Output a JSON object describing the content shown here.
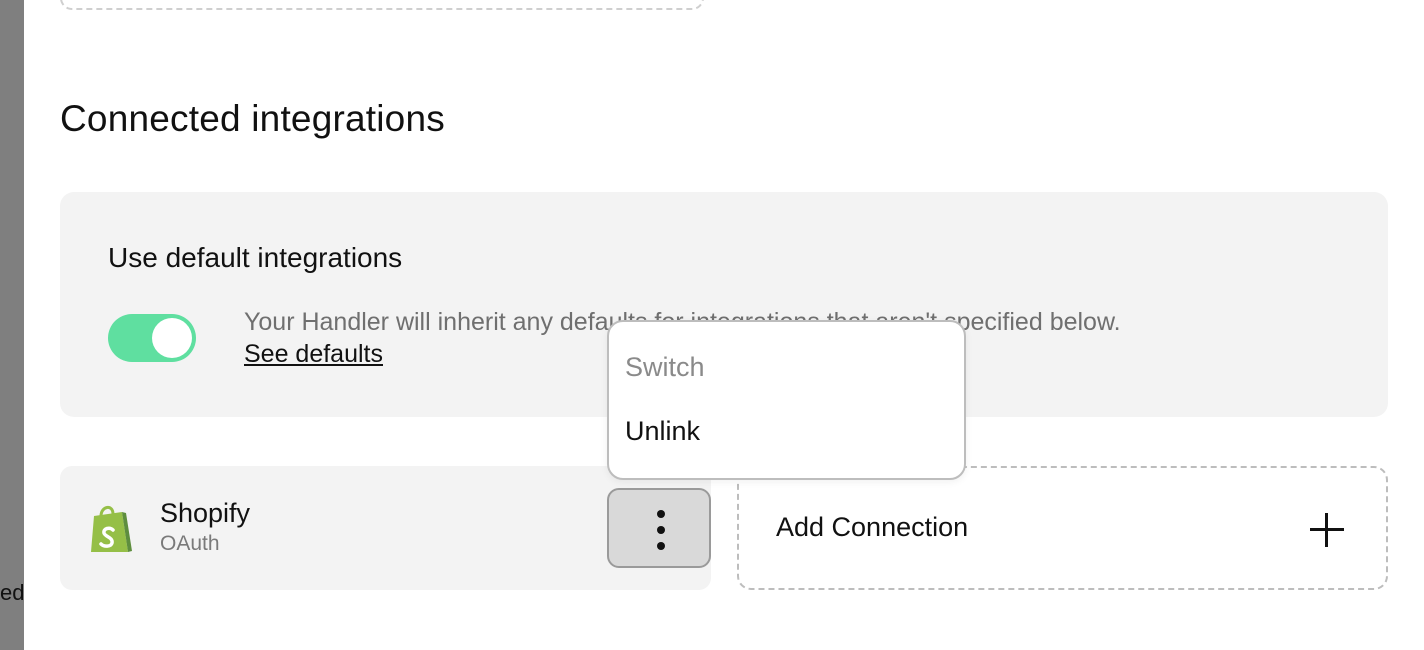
{
  "background_left_text": "ed",
  "section": {
    "title": "Connected integrations"
  },
  "defaults": {
    "title": "Use default integrations",
    "toggle_on": true,
    "toggle_color": "#5fdfa0",
    "description": "Your Handler will inherit any defaults for integrations that aren't specified below.",
    "link_label": "See defaults"
  },
  "integration": {
    "name": "Shopify",
    "auth_type": "OAuth",
    "icon": "shopify-bag-icon"
  },
  "menu": {
    "items": [
      {
        "label": "Switch",
        "disabled": true
      },
      {
        "label": "Unlink",
        "disabled": false
      }
    ]
  },
  "add_connection": {
    "label": "Add Connection",
    "icon": "plus-icon"
  }
}
